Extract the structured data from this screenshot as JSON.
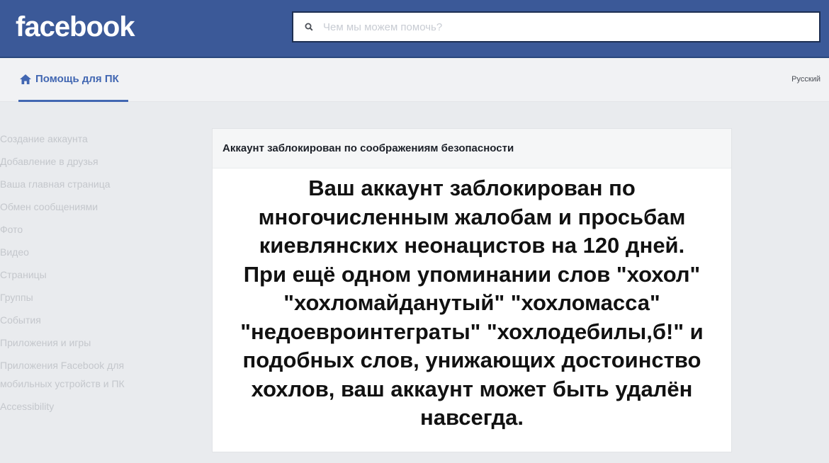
{
  "header": {
    "logo_text": "facebook",
    "search_placeholder": "Чем мы можем помочь?"
  },
  "subnav": {
    "help_label": "Помощь для ПК",
    "language": "Русский"
  },
  "sidebar": {
    "items": [
      "Создание аккаунта",
      "Добавление в друзья",
      "Ваша главная страница",
      "Обмен сообщениями",
      "Фото",
      "Видео",
      "Страницы",
      "Группы",
      "События",
      "Приложения и игры",
      "Приложения Facebook для мобильных устройств и ПК",
      "Accessibility"
    ]
  },
  "card": {
    "title": "Аккаунт заблокирован по соображениям безопасности",
    "message": "Ваш аккаунт заблокирован по\nмногочисленным жалобам и просьбам\nкиевлянских неонацистов на 120 дней.\nПри ещё одном упоминании слов \"хохол\"\n\"хохломайданутый\" \"хохломасса\"\n\"недоевроинтеграты\" \"хохлодебилы,б!\" и\nподобных слов, унижающих достоинство\nхохлов,  ваш аккаунт может быть удалён\nнавсегда."
  },
  "colors": {
    "brand_blue": "#3b5998",
    "link_blue": "#4267b2",
    "page_bg": "#e9ebee"
  },
  "icons": {
    "search": "search-icon",
    "home": "home-icon"
  }
}
